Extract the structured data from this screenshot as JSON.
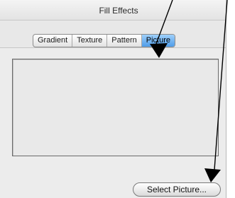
{
  "window": {
    "title": "Fill Effects"
  },
  "tabs": [
    {
      "label": "Gradient",
      "selected": false
    },
    {
      "label": "Texture",
      "selected": false
    },
    {
      "label": "Pattern",
      "selected": false
    },
    {
      "label": "Picture",
      "selected": true
    }
  ],
  "buttons": {
    "select_picture": "Select Picture..."
  },
  "colors": {
    "selected_tab": "#4f9ce8",
    "annotation_arrow": "#000000"
  },
  "annotations": {
    "arrow_icons": [
      "arrow-to-picture-tab",
      "arrow-to-select-picture-button"
    ]
  }
}
